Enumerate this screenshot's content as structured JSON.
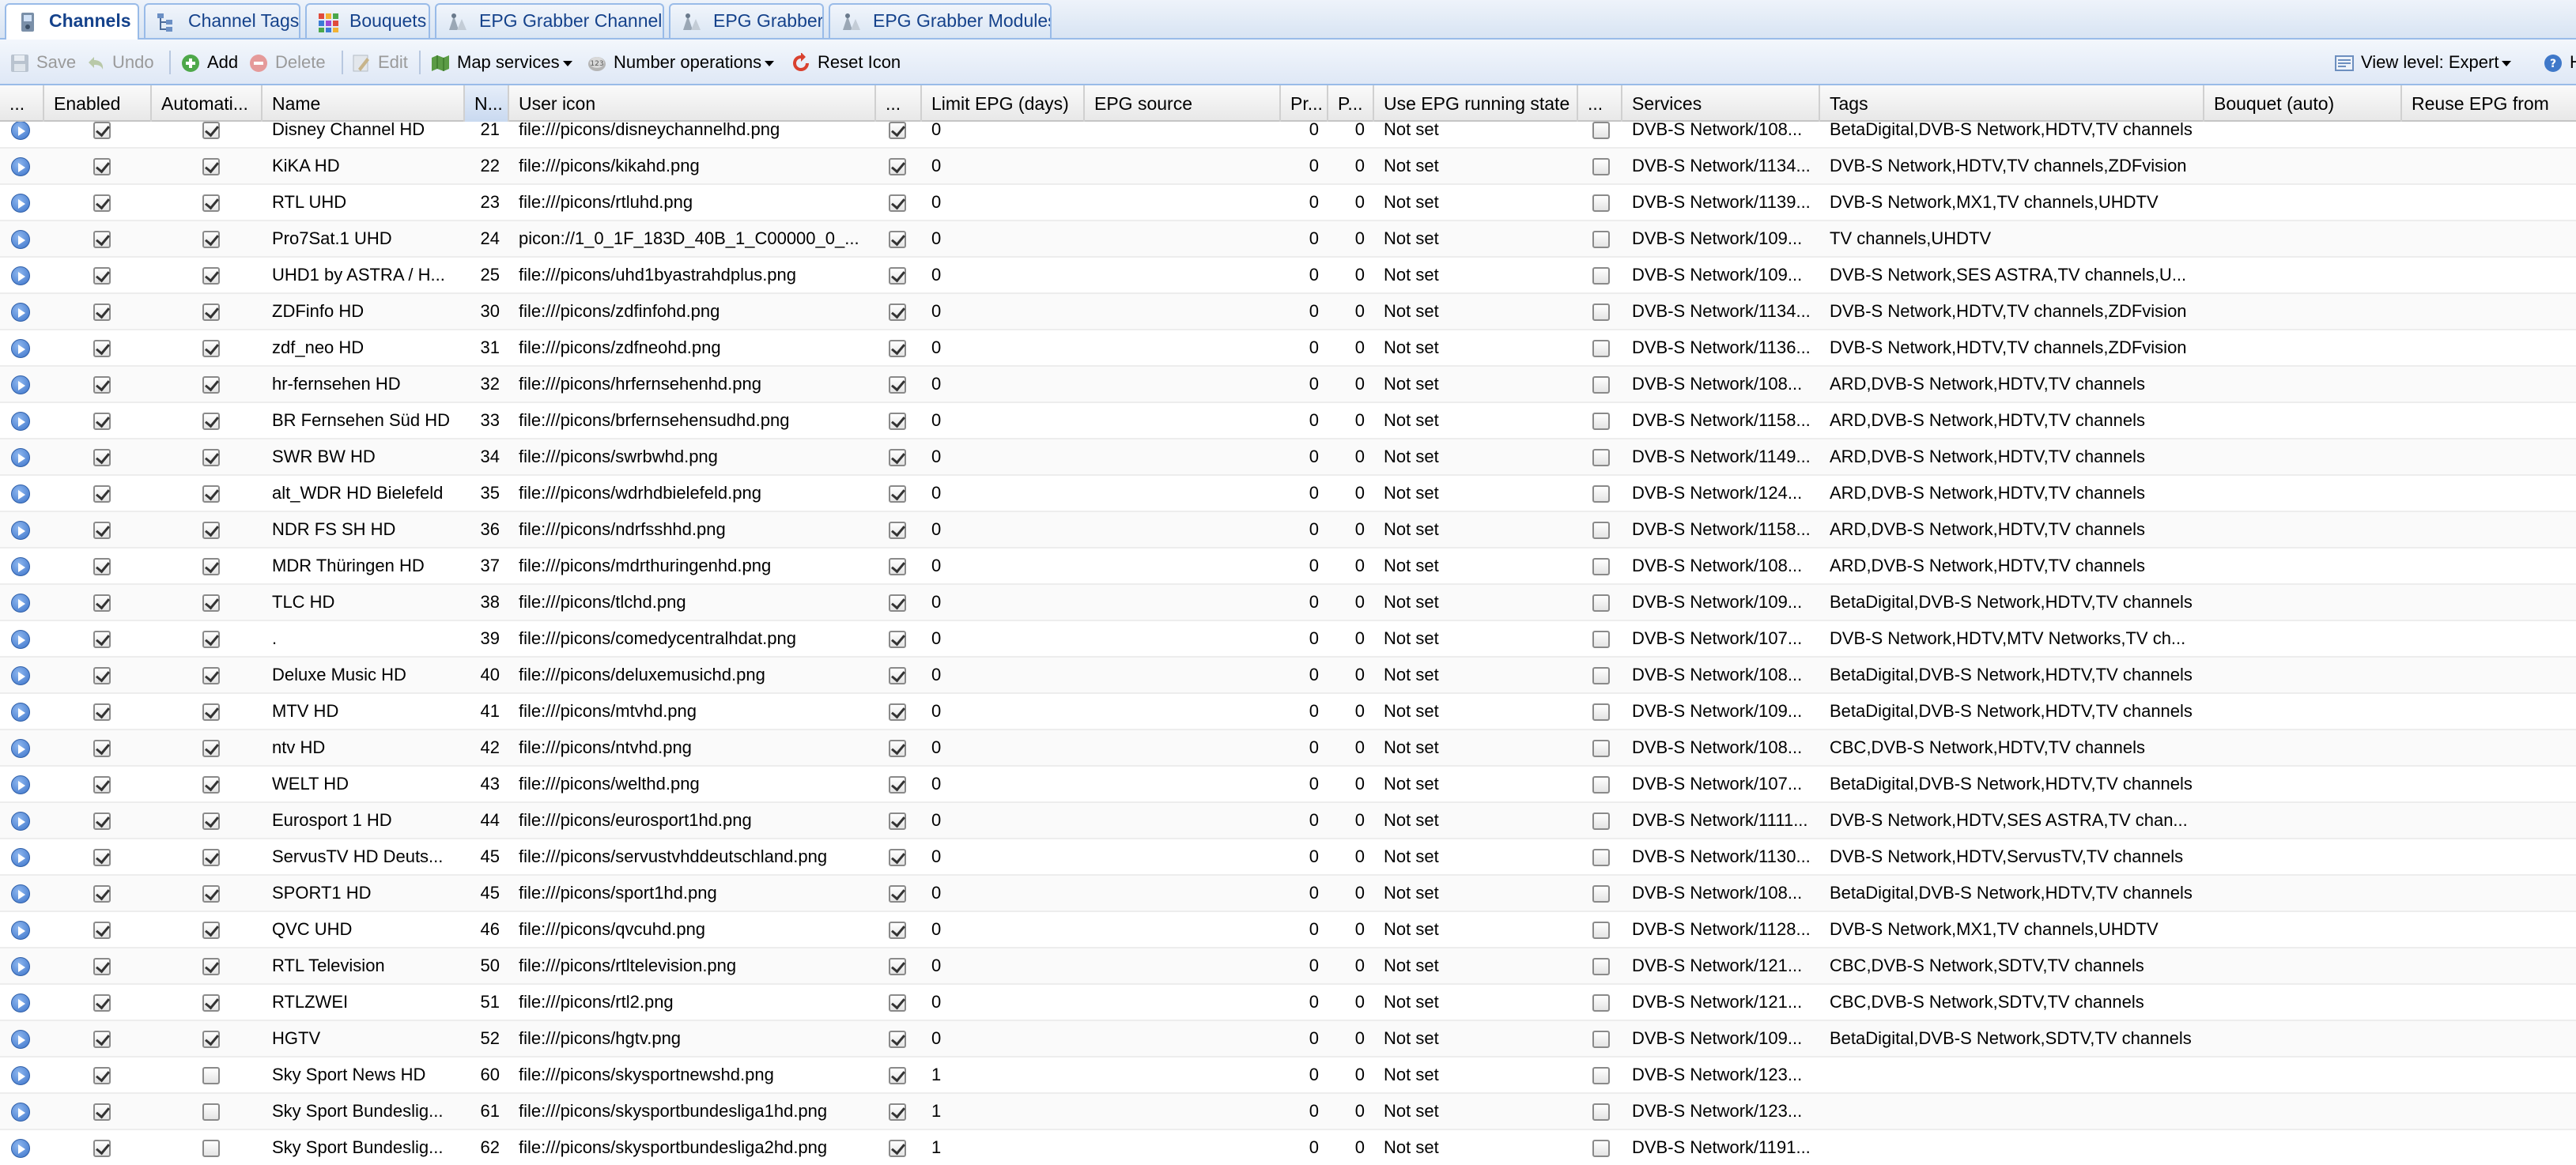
{
  "tabs": [
    {
      "label": "Channels",
      "icon": "tv-icon",
      "active": true
    },
    {
      "label": "Channel Tags",
      "icon": "tag-tree-icon",
      "active": false
    },
    {
      "label": "Bouquets",
      "icon": "bouquet-grid-icon",
      "active": false
    },
    {
      "label": "EPG Grabber Channels",
      "icon": "epg-channels-icon",
      "active": false
    },
    {
      "label": "EPG Grabber",
      "icon": "epg-grabber-icon",
      "active": false
    },
    {
      "label": "EPG Grabber Modules",
      "icon": "epg-modules-icon",
      "active": false
    }
  ],
  "toolbar": {
    "save": "Save",
    "undo": "Undo",
    "add": "Add",
    "delete": "Delete",
    "edit": "Edit",
    "map_services": "Map services",
    "number_operations": "Number operations",
    "reset_icon": "Reset Icon",
    "view_level": "View level: Expert",
    "help": "H"
  },
  "columns": {
    "play": "...",
    "enabled": "Enabled",
    "auto": "Automati...",
    "name": "Name",
    "number": "N...",
    "icon": "User icon",
    "icon_pub": "...",
    "limit_epg": "Limit EPG (days)",
    "epg_source": "EPG source",
    "pr": "Pr...",
    "p": "P...",
    "epg_running": "Use EPG running state",
    "epg_opt": "...",
    "services": "Services",
    "tags": "Tags",
    "bouquet": "Bouquet (auto)",
    "reuse_epg": "Reuse EPG from"
  },
  "rows": [
    {
      "name": "Disney Channel HD",
      "number": "21",
      "icon": "file:///picons/disneychannelhd.png",
      "limit": "0",
      "pr": "0",
      "p": "0",
      "running": "Not set",
      "services": "DVB-S Network/108...",
      "tags": "BetaDigital,DVB-S Network,HDTV,TV channels",
      "auto": true
    },
    {
      "name": "KiKA HD",
      "number": "22",
      "icon": "file:///picons/kikahd.png",
      "limit": "0",
      "pr": "0",
      "p": "0",
      "running": "Not set",
      "services": "DVB-S Network/1134...",
      "tags": "DVB-S Network,HDTV,TV channels,ZDFvision",
      "auto": true
    },
    {
      "name": "RTL UHD",
      "number": "23",
      "icon": "file:///picons/rtluhd.png",
      "limit": "0",
      "pr": "0",
      "p": "0",
      "running": "Not set",
      "services": "DVB-S Network/1139...",
      "tags": "DVB-S Network,MX1,TV channels,UHDTV",
      "auto": true
    },
    {
      "name": "Pro7Sat.1 UHD",
      "number": "24",
      "icon": "picon://1_0_1F_183D_40B_1_C00000_0_...",
      "limit": "0",
      "pr": "0",
      "p": "0",
      "running": "Not set",
      "services": "DVB-S Network/109...",
      "tags": "TV channels,UHDTV",
      "auto": true
    },
    {
      "name": "UHD1 by ASTRA / H...",
      "number": "25",
      "icon": "file:///picons/uhd1byastrahdplus.png",
      "limit": "0",
      "pr": "0",
      "p": "0",
      "running": "Not set",
      "services": "DVB-S Network/109...",
      "tags": "DVB-S Network,SES ASTRA,TV channels,U...",
      "auto": true
    },
    {
      "name": "ZDFinfo HD",
      "number": "30",
      "icon": "file:///picons/zdfinfohd.png",
      "limit": "0",
      "pr": "0",
      "p": "0",
      "running": "Not set",
      "services": "DVB-S Network/1134...",
      "tags": "DVB-S Network,HDTV,TV channels,ZDFvision",
      "auto": true
    },
    {
      "name": "zdf_neo HD",
      "number": "31",
      "icon": "file:///picons/zdfneohd.png",
      "limit": "0",
      "pr": "0",
      "p": "0",
      "running": "Not set",
      "services": "DVB-S Network/1136...",
      "tags": "DVB-S Network,HDTV,TV channels,ZDFvision",
      "auto": true
    },
    {
      "name": "hr-fernsehen HD",
      "number": "32",
      "icon": "file:///picons/hrfernsehenhd.png",
      "limit": "0",
      "pr": "0",
      "p": "0",
      "running": "Not set",
      "services": "DVB-S Network/108...",
      "tags": "ARD,DVB-S Network,HDTV,TV channels",
      "auto": true
    },
    {
      "name": "BR Fernsehen Süd HD",
      "number": "33",
      "icon": "file:///picons/brfernsehensudhd.png",
      "limit": "0",
      "pr": "0",
      "p": "0",
      "running": "Not set",
      "services": "DVB-S Network/1158...",
      "tags": "ARD,DVB-S Network,HDTV,TV channels",
      "auto": true
    },
    {
      "name": "SWR BW HD",
      "number": "34",
      "icon": "file:///picons/swrbwhd.png",
      "limit": "0",
      "pr": "0",
      "p": "0",
      "running": "Not set",
      "services": "DVB-S Network/1149...",
      "tags": "ARD,DVB-S Network,HDTV,TV channels",
      "auto": true
    },
    {
      "name": "alt_WDR HD Bielefeld",
      "number": "35",
      "icon": "file:///picons/wdrhdbielefeld.png",
      "limit": "0",
      "pr": "0",
      "p": "0",
      "running": "Not set",
      "services": "DVB-S Network/124...",
      "tags": "ARD,DVB-S Network,HDTV,TV channels",
      "auto": true
    },
    {
      "name": "NDR FS SH HD",
      "number": "36",
      "icon": "file:///picons/ndrfsshhd.png",
      "limit": "0",
      "pr": "0",
      "p": "0",
      "running": "Not set",
      "services": "DVB-S Network/1158...",
      "tags": "ARD,DVB-S Network,HDTV,TV channels",
      "auto": true
    },
    {
      "name": "MDR Thüringen HD",
      "number": "37",
      "icon": "file:///picons/mdrthuringenhd.png",
      "limit": "0",
      "pr": "0",
      "p": "0",
      "running": "Not set",
      "services": "DVB-S Network/108...",
      "tags": "ARD,DVB-S Network,HDTV,TV channels",
      "auto": true
    },
    {
      "name": "TLC HD",
      "number": "38",
      "icon": "file:///picons/tlchd.png",
      "limit": "0",
      "pr": "0",
      "p": "0",
      "running": "Not set",
      "services": "DVB-S Network/109...",
      "tags": "BetaDigital,DVB-S Network,HDTV,TV channels",
      "auto": true
    },
    {
      "name": ".",
      "number": "39",
      "icon": "file:///picons/comedycentralhdat.png",
      "limit": "0",
      "pr": "0",
      "p": "0",
      "running": "Not set",
      "services": "DVB-S Network/107...",
      "tags": "DVB-S Network,HDTV,MTV Networks,TV ch...",
      "auto": true
    },
    {
      "name": "Deluxe Music HD",
      "number": "40",
      "icon": "file:///picons/deluxemusichd.png",
      "limit": "0",
      "pr": "0",
      "p": "0",
      "running": "Not set",
      "services": "DVB-S Network/108...",
      "tags": "BetaDigital,DVB-S Network,HDTV,TV channels",
      "auto": true
    },
    {
      "name": "MTV HD",
      "number": "41",
      "icon": "file:///picons/mtvhd.png",
      "limit": "0",
      "pr": "0",
      "p": "0",
      "running": "Not set",
      "services": "DVB-S Network/109...",
      "tags": "BetaDigital,DVB-S Network,HDTV,TV channels",
      "auto": true
    },
    {
      "name": "ntv HD",
      "number": "42",
      "icon": "file:///picons/ntvhd.png",
      "limit": "0",
      "pr": "0",
      "p": "0",
      "running": "Not set",
      "services": "DVB-S Network/108...",
      "tags": "CBC,DVB-S Network,HDTV,TV channels",
      "auto": true
    },
    {
      "name": "WELT HD",
      "number": "43",
      "icon": "file:///picons/welthd.png",
      "limit": "0",
      "pr": "0",
      "p": "0",
      "running": "Not set",
      "services": "DVB-S Network/107...",
      "tags": "BetaDigital,DVB-S Network,HDTV,TV channels",
      "auto": true
    },
    {
      "name": "Eurosport 1 HD",
      "number": "44",
      "icon": "file:///picons/eurosport1hd.png",
      "limit": "0",
      "pr": "0",
      "p": "0",
      "running": "Not set",
      "services": "DVB-S Network/1111...",
      "tags": "DVB-S Network,HDTV,SES ASTRA,TV chan...",
      "auto": true
    },
    {
      "name": "ServusTV HD Deuts...",
      "number": "45",
      "icon": "file:///picons/servustvhddeutschland.png",
      "limit": "0",
      "pr": "0",
      "p": "0",
      "running": "Not set",
      "services": "DVB-S Network/1130...",
      "tags": "DVB-S Network,HDTV,ServusTV,TV channels",
      "auto": true
    },
    {
      "name": "SPORT1 HD",
      "number": "45",
      "icon": "file:///picons/sport1hd.png",
      "limit": "0",
      "pr": "0",
      "p": "0",
      "running": "Not set",
      "services": "DVB-S Network/108...",
      "tags": "BetaDigital,DVB-S Network,HDTV,TV channels",
      "auto": true
    },
    {
      "name": "QVC UHD",
      "number": "46",
      "icon": "file:///picons/qvcuhd.png",
      "limit": "0",
      "pr": "0",
      "p": "0",
      "running": "Not set",
      "services": "DVB-S Network/1128...",
      "tags": "DVB-S Network,MX1,TV channels,UHDTV",
      "auto": true
    },
    {
      "name": "RTL Television",
      "number": "50",
      "icon": "file:///picons/rtltelevision.png",
      "limit": "0",
      "pr": "0",
      "p": "0",
      "running": "Not set",
      "services": "DVB-S Network/121...",
      "tags": "CBC,DVB-S Network,SDTV,TV channels",
      "auto": true
    },
    {
      "name": "RTLZWEI",
      "number": "51",
      "icon": "file:///picons/rtl2.png",
      "limit": "0",
      "pr": "0",
      "p": "0",
      "running": "Not set",
      "services": "DVB-S Network/121...",
      "tags": "CBC,DVB-S Network,SDTV,TV channels",
      "auto": true
    },
    {
      "name": "HGTV",
      "number": "52",
      "icon": "file:///picons/hgtv.png",
      "limit": "0",
      "pr": "0",
      "p": "0",
      "running": "Not set",
      "services": "DVB-S Network/109...",
      "tags": "BetaDigital,DVB-S Network,SDTV,TV channels",
      "auto": true
    },
    {
      "name": "Sky Sport News HD",
      "number": "60",
      "icon": "file:///picons/skysportnewshd.png",
      "limit": "1",
      "pr": "0",
      "p": "0",
      "running": "Not set",
      "services": "DVB-S Network/123...",
      "tags": "",
      "auto": false
    },
    {
      "name": "Sky Sport Bundeslig...",
      "number": "61",
      "icon": "file:///picons/skysportbundesliga1hd.png",
      "limit": "1",
      "pr": "0",
      "p": "0",
      "running": "Not set",
      "services": "DVB-S Network/123...",
      "tags": "",
      "auto": false
    },
    {
      "name": "Sky Sport Bundeslig...",
      "number": "62",
      "icon": "file:///picons/skysportbundesliga2hd.png",
      "limit": "1",
      "pr": "0",
      "p": "0",
      "running": "Not set",
      "services": "DVB-S Network/1191...",
      "tags": "",
      "auto": false
    }
  ]
}
